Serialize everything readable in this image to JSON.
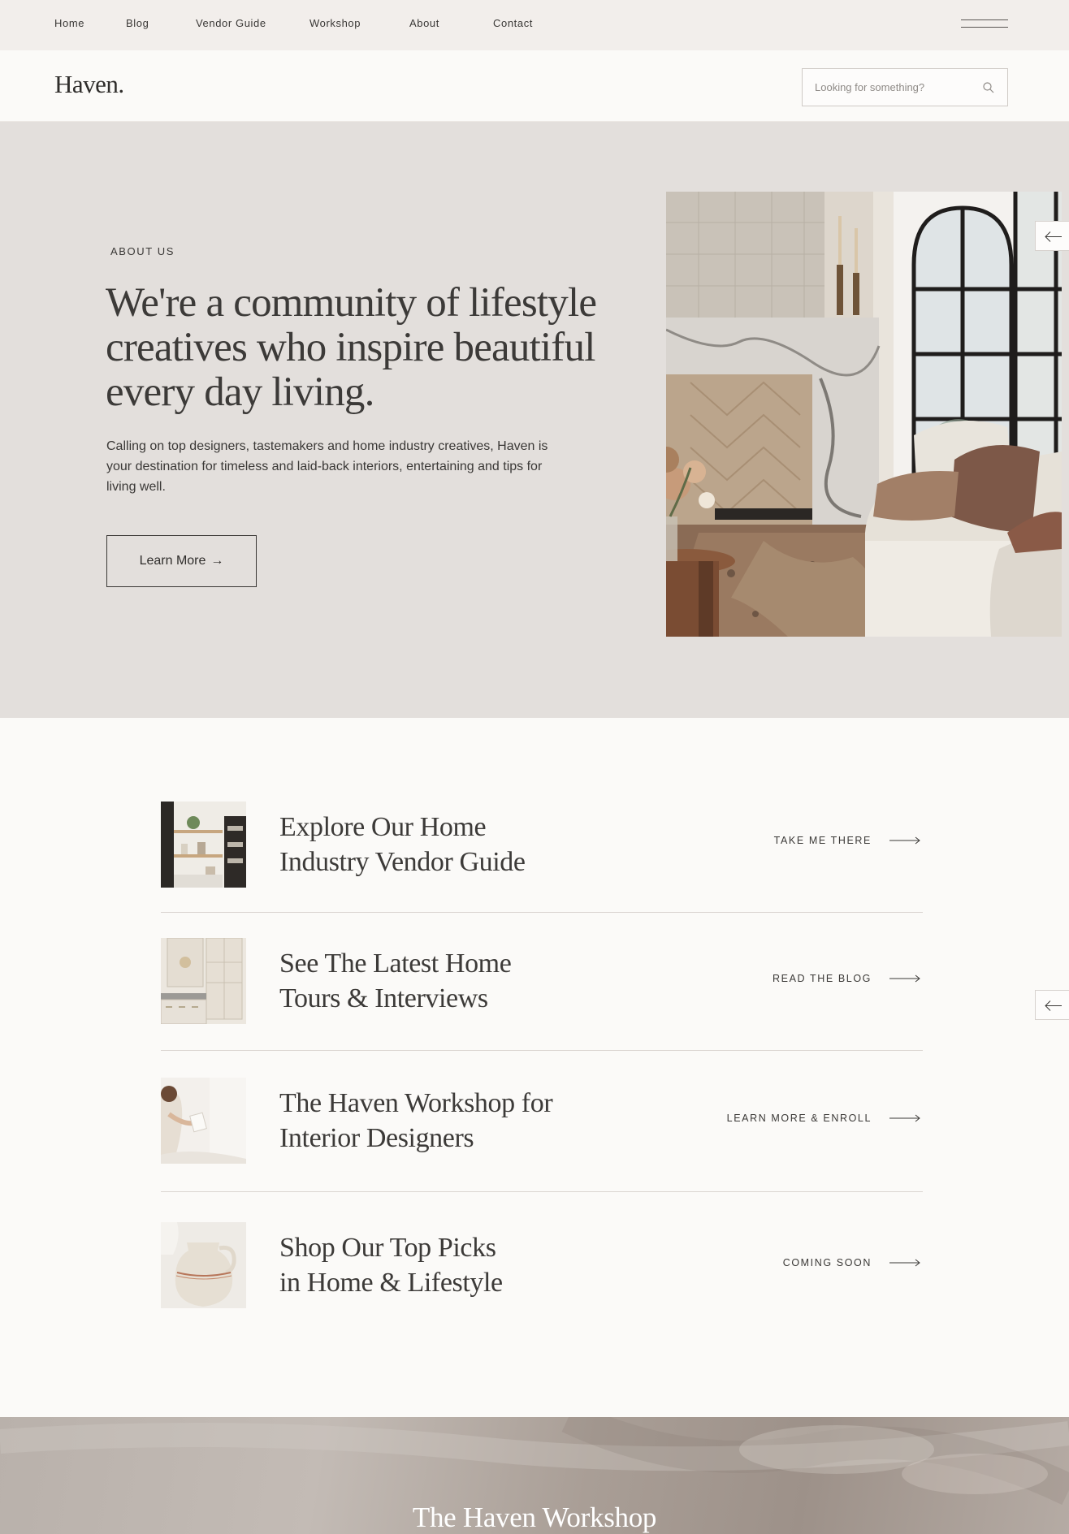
{
  "nav": {
    "items": [
      {
        "label": "Home"
      },
      {
        "label": "Blog"
      },
      {
        "label": "Vendor Guide"
      },
      {
        "label": "Workshop"
      },
      {
        "label": "About"
      },
      {
        "label": "Contact"
      }
    ],
    "menu_icon": "hamburger-icon"
  },
  "header": {
    "logo": "Haven.",
    "search_placeholder": "Looking for something?",
    "search_icon": "search-icon"
  },
  "hero": {
    "eyebrow": "ABOUT US",
    "headline": "We're a community of lifestyle creatives who inspire beautiful every day living.",
    "body": "Calling on top designers, tastemakers and home industry creatives, Haven is your destination for timeless and laid-back interiors, entertaining and tips for living well.",
    "cta_label": "Learn More",
    "cta_arrow": "→",
    "image": "living-room-fireplace-photo",
    "prev_icon": "arrow-left-icon"
  },
  "features": [
    {
      "title_line1": "Explore Our Home",
      "title_line2": "Industry Vendor Guide",
      "cta": "TAKE ME THERE",
      "image": "kitchen-shelves-photo"
    },
    {
      "title_line1": "See The Latest Home",
      "title_line2": "Tours & Interviews",
      "cta": "READ THE BLOG",
      "image": "cabinet-kitchen-photo"
    },
    {
      "title_line1": "The Haven Workshop for",
      "title_line2": "Interior Designers",
      "cta": "LEARN MORE & ENROLL",
      "image": "woman-reading-photo"
    },
    {
      "title_line1": "Shop Our Top Picks",
      "title_line2": "in Home & Lifestyle",
      "cta": "COMING SOON",
      "image": "ceramic-vase-photo"
    }
  ],
  "side_arrow_icon": "arrow-left-icon",
  "workshop_banner": {
    "title": "The Haven Workshop"
  },
  "colors": {
    "top_nav_bg": "#f2eeeb",
    "page_bg": "#fbfaf8",
    "hero_bg": "#e3dfdc",
    "text": "#3a3836"
  }
}
